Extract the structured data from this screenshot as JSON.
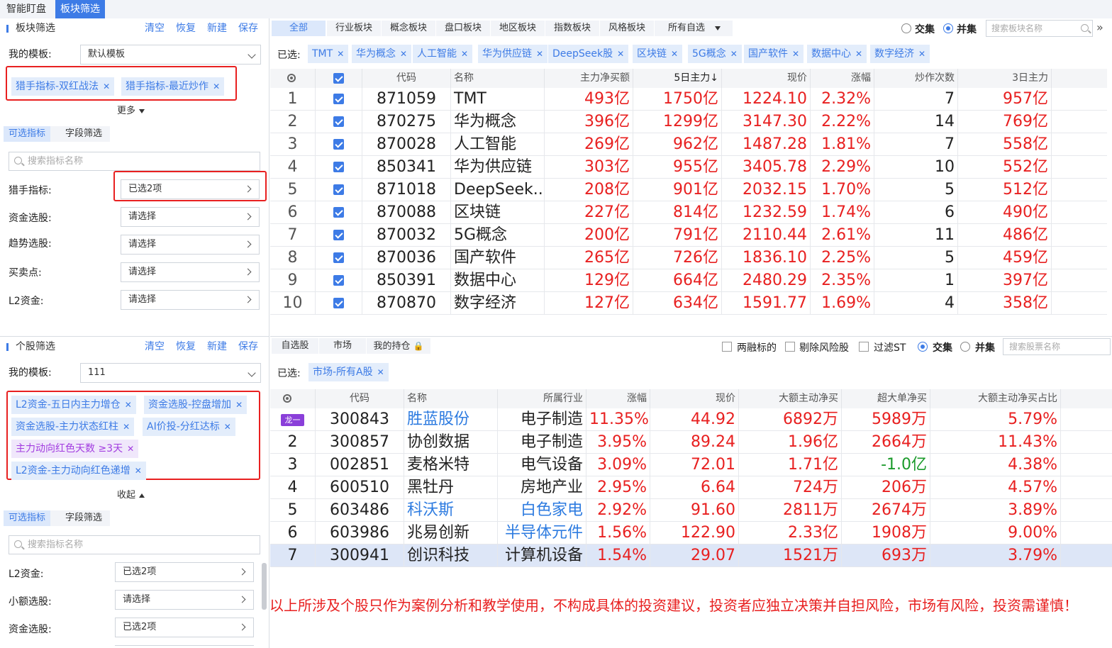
{
  "top_tabs": [
    "智能盯盘",
    "板块筛选"
  ],
  "sector_filter": {
    "title": "板块筛选",
    "actions": [
      "清空",
      "恢复",
      "新建",
      "保存"
    ],
    "template_label": "我的模板:",
    "template_value": "默认模板",
    "chips": [
      "猎手指标-双红战法",
      "猎手指标-最近炒作"
    ],
    "more_label": "更多",
    "subtabs": [
      "可选指标",
      "字段筛选"
    ],
    "search_placeholder": "搜索指标名称",
    "fields": [
      {
        "label": "猎手指标:",
        "value": "已选2项"
      },
      {
        "label": "资金选股:",
        "value": "请选择"
      },
      {
        "label": "趋势选股:",
        "value": "请选择"
      },
      {
        "label": "买卖点:",
        "value": "请选择"
      },
      {
        "label": "L2资金:",
        "value": "请选择"
      }
    ]
  },
  "stock_filter": {
    "title": "个股筛选",
    "actions": [
      "清空",
      "恢复",
      "新建",
      "保存"
    ],
    "template_label": "我的模板:",
    "template_value": "111",
    "chips": [
      "L2资金-五日内主力增仓",
      "资金选股-控盘增加",
      "资金选股-主力状态红柱",
      "AI价投-分红达标",
      "主力动向红色天数 ≥3天",
      "L2资金-主力动向红色递增"
    ],
    "collapse_label": "收起",
    "subtabs": [
      "可选指标",
      "字段筛选"
    ],
    "search_placeholder": "搜索指标名称",
    "fields": [
      {
        "label": "L2资金:",
        "value": "已选2项"
      },
      {
        "label": "小额选股:",
        "value": "请选择"
      },
      {
        "label": "资金选股:",
        "value": "已选2项"
      }
    ]
  },
  "sector_table": {
    "category_tabs": [
      "全部",
      "行业板块",
      "概念板块",
      "盘口板块",
      "地区板块",
      "指数板块",
      "风格板块",
      "所有自选"
    ],
    "mode_options": [
      "交集",
      "并集"
    ],
    "selected_mode": "并集",
    "search_placeholder": "搜索板块名称",
    "selected_label": "已选:",
    "selected_chips": [
      "TMT",
      "华为概念",
      "人工智能",
      "华为供应链",
      "DeepSeek股",
      "区块链",
      "5G概念",
      "国产软件",
      "数据中心",
      "数字经济"
    ],
    "columns": [
      "代码",
      "名称",
      "主力净买额",
      "5日主力↓",
      "现价",
      "涨幅",
      "炒作次数",
      "3日主力"
    ],
    "rows": [
      [
        "1",
        "871059",
        "TMT",
        "493亿",
        "1750亿",
        "1224.10",
        "2.32%",
        "7",
        "957亿"
      ],
      [
        "2",
        "870275",
        "华为概念",
        "396亿",
        "1299亿",
        "3147.30",
        "2.22%",
        "14",
        "769亿"
      ],
      [
        "3",
        "870028",
        "人工智能",
        "269亿",
        "962亿",
        "1487.28",
        "1.81%",
        "7",
        "558亿"
      ],
      [
        "4",
        "850341",
        "华为供应链",
        "303亿",
        "955亿",
        "3405.78",
        "2.29%",
        "10",
        "552亿"
      ],
      [
        "5",
        "871018",
        "DeepSeek...",
        "208亿",
        "901亿",
        "2032.15",
        "1.70%",
        "5",
        "512亿"
      ],
      [
        "6",
        "870088",
        "区块链",
        "227亿",
        "814亿",
        "1232.59",
        "1.74%",
        "6",
        "490亿"
      ],
      [
        "7",
        "870032",
        "5G概念",
        "200亿",
        "791亿",
        "2110.44",
        "2.61%",
        "11",
        "486亿"
      ],
      [
        "8",
        "870036",
        "国产软件",
        "265亿",
        "726亿",
        "1836.10",
        "2.25%",
        "5",
        "459亿"
      ],
      [
        "9",
        "850391",
        "数据中心",
        "129亿",
        "664亿",
        "2480.29",
        "2.35%",
        "1",
        "397亿"
      ],
      [
        "10",
        "870870",
        "数字经济",
        "127亿",
        "634亿",
        "1591.77",
        "1.69%",
        "4",
        "358亿"
      ]
    ]
  },
  "stock_table": {
    "tabs": [
      "自选股",
      "市场",
      "我的持仓"
    ],
    "check_options": [
      "两融标的",
      "剔除风险股",
      "过滤ST"
    ],
    "mode_options": [
      "交集",
      "并集"
    ],
    "selected_mode": "交集",
    "search_placeholder": "搜索股票名称",
    "selected_label": "已选:",
    "selected_chips": [
      "市场-所有A股"
    ],
    "columns": [
      "代码",
      "名称",
      "所属行业",
      "涨幅",
      "现价",
      "大额主动净买",
      "超大单净买",
      "大额主动净买占比"
    ],
    "badge": "龙一",
    "rows": [
      [
        "",
        "300843",
        "胜蓝股份",
        "电子制造",
        "11.35%",
        "44.92",
        "6892万",
        "5989万",
        "5.79%"
      ],
      [
        "2",
        "300857",
        "协创数据",
        "电子制造",
        "3.95%",
        "89.24",
        "1.96亿",
        "2664万",
        "11.43%"
      ],
      [
        "3",
        "002851",
        "麦格米特",
        "电气设备",
        "3.09%",
        "72.01",
        "1.71亿",
        "-1.0亿",
        "4.38%"
      ],
      [
        "4",
        "600510",
        "黑牡丹",
        "房地产业",
        "2.95%",
        "6.64",
        "724万",
        "206万",
        "4.57%"
      ],
      [
        "5",
        "603486",
        "科沃斯",
        "白色家电",
        "2.92%",
        "91.60",
        "2811万",
        "2674万",
        "3.89%"
      ],
      [
        "6",
        "603986",
        "兆易创新",
        "半导体元件",
        "1.56%",
        "122.90",
        "2.33亿",
        "1908万",
        "9.00%"
      ],
      [
        "7",
        "300941",
        "创识科技",
        "计算机设备",
        "1.54%",
        "29.07",
        "1521万",
        "693万",
        "3.79%"
      ]
    ]
  },
  "disclaimer": "以上所涉及个股只作为案例分析和教学使用，不构成具体的投资建议，投资者应独立决策并自担风险，市场有风险，投资需谨慎！",
  "colors": {
    "accent": "#3d7be6",
    "up": "#e82020",
    "down": "#1a9a2a",
    "highlight_border": "#e82020",
    "badge": "#8a3fd9"
  }
}
